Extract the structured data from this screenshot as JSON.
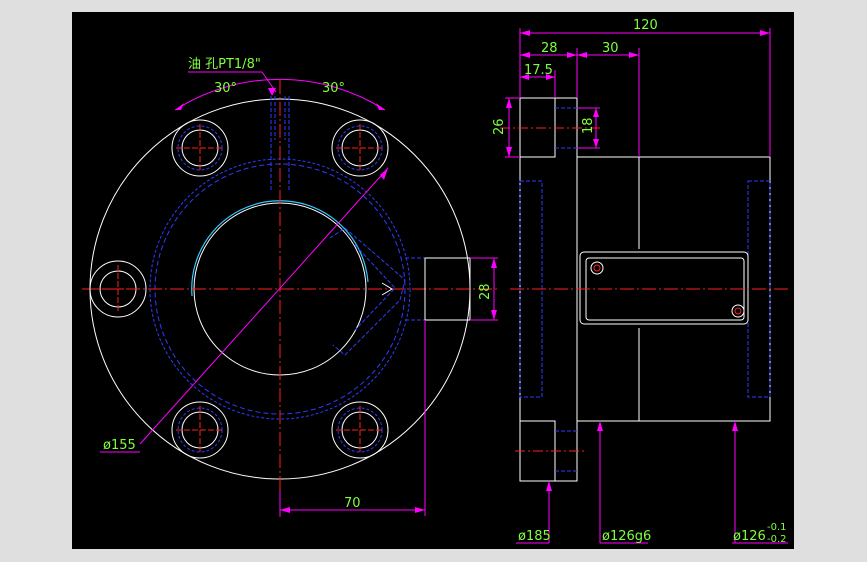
{
  "colors": {
    "frame": "#dfdfdf",
    "background": "#000000",
    "outline": "#ffffff",
    "hidden": "#2d3cff",
    "centerline": "#ff2020",
    "dimension": "#ff00ff",
    "dimension_text": "#7fff3c",
    "bore_highlight": "#35c8ff"
  },
  "annotations": {
    "oil_hole": "油 孔PT1/8\"",
    "angle_left": "30°",
    "angle_right": "30°",
    "dia_155": "ø155",
    "dim_70": "70",
    "dim_28_front": "28",
    "dim_120": "120",
    "dim_28_top": "28",
    "dim_30": "30",
    "dim_17_5": "17.5",
    "dim_26": "26",
    "dim_18": "18",
    "dia_185": "ø185",
    "dia_126g6": "ø126g6",
    "dia_126_base": "ø126",
    "tol_upper": "-0.1",
    "tol_lower": "-0.2"
  }
}
